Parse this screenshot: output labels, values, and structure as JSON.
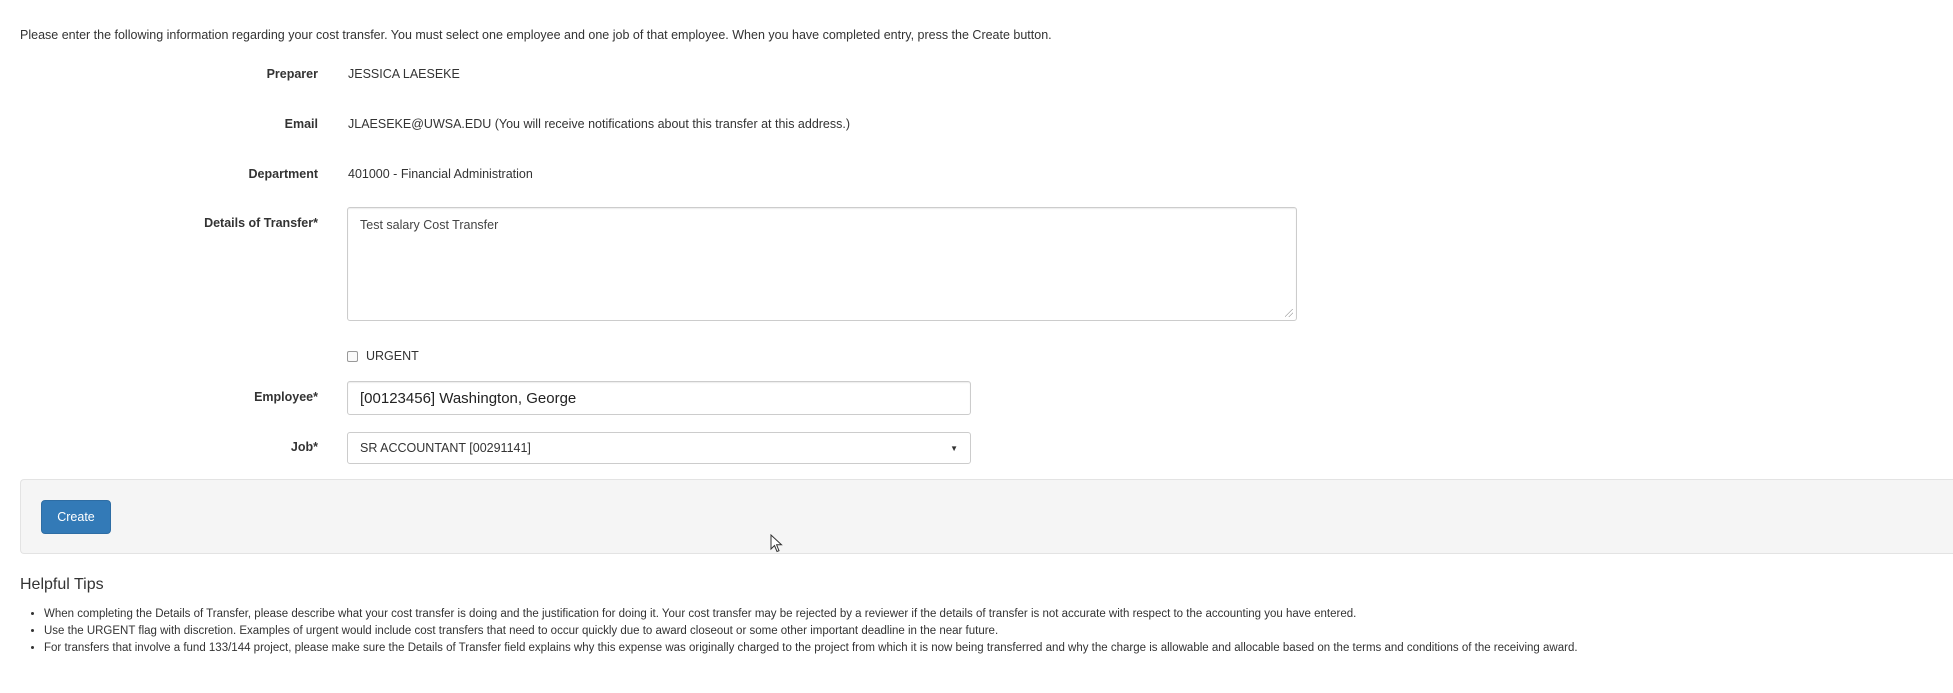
{
  "intro_text": "Please enter the following information regarding your cost transfer. You must select one employee and one job of that employee. When you have completed entry, press the Create button.",
  "form": {
    "preparer": {
      "label": "Preparer",
      "value": "JESSICA LAESEKE"
    },
    "email": {
      "label": "Email",
      "value": "JLAESEKE@UWSA.EDU (You will receive notifications about this transfer at this address.)"
    },
    "department": {
      "label": "Department",
      "value": "401000 - Financial Administration"
    },
    "details": {
      "label": "Details of Transfer*",
      "value": "Test salary Cost Transfer"
    },
    "urgent": {
      "label": "URGENT",
      "checked": false
    },
    "employee": {
      "label": "Employee*",
      "value": "[00123456] Washington, George"
    },
    "job": {
      "label": "Job*",
      "value": "SR ACCOUNTANT [00291141]"
    }
  },
  "actions": {
    "create_label": "Create",
    "create_color": "#337ab7"
  },
  "tips": {
    "title": "Helpful Tips",
    "items": [
      "When completing the Details of Transfer, please describe what your cost transfer is doing and the justification for doing it. Your cost transfer may be rejected by a reviewer if the details of transfer is not accurate with respect to the accounting you have entered.",
      "Use the URGENT flag with discretion. Examples of urgent would include cost transfers that need to occur quickly due to award closeout or some other important deadline in the near future.",
      "For transfers that involve a fund 133/144 project, please make sure the Details of Transfer field explains why this expense was originally charged to the project from which it is now being transferred and why the charge is allowable and allocable based on the terms and conditions of the receiving award."
    ]
  },
  "icons": {
    "select_caret": "caret-down-icon",
    "cursor": "mouse-pointer-icon"
  }
}
